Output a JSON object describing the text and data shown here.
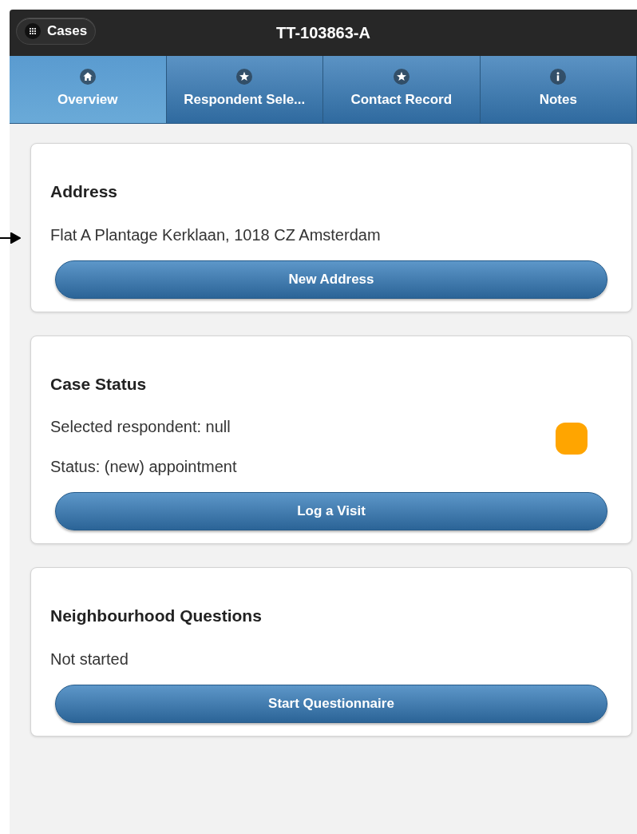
{
  "header": {
    "back_button": "Cases",
    "title": "TT-103863-A"
  },
  "tabs": [
    {
      "label": "Overview",
      "kind": "home",
      "selected": true
    },
    {
      "label": "Respondent Sele...",
      "kind": "star",
      "selected": false
    },
    {
      "label": "Contact Record",
      "kind": "star",
      "selected": false
    },
    {
      "label": "Notes",
      "kind": "info",
      "selected": false
    }
  ],
  "cards": [
    {
      "title": "Address",
      "lines": [
        "Flat A Plantage Kerklaan, 1018 CZ Amsterdam"
      ],
      "button": "New Address",
      "pointer_arrow": true
    },
    {
      "title": "Case Status",
      "lines": [
        "Selected respondent: null",
        "Status: (new) appointment"
      ],
      "button": "Log a Visit",
      "color": "#ffa500"
    },
    {
      "title": "Neighbourhood Questions",
      "lines": [
        "Not started"
      ],
      "button": "Start Questionnaire"
    }
  ]
}
